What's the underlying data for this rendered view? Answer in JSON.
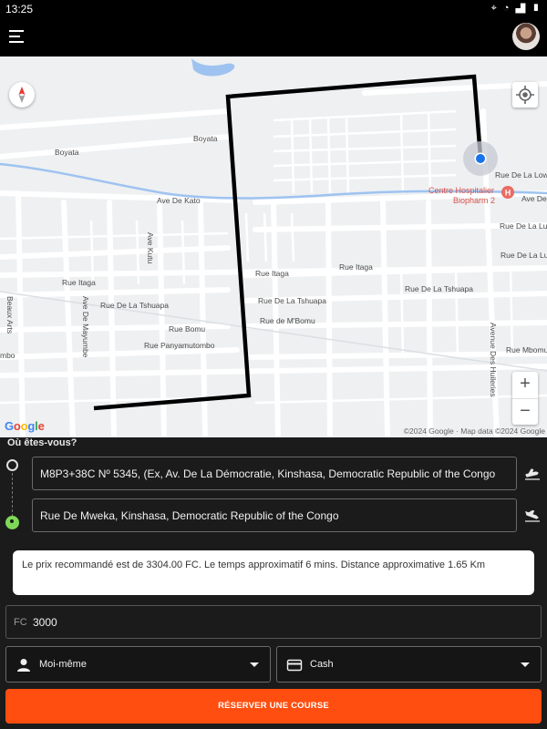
{
  "status_bar": {
    "time": "13:25",
    "icons": [
      "location-icon",
      "wifi-icon",
      "signal-icon",
      "battery-icon"
    ]
  },
  "app_bar": {
    "menu_icon": "hamburger-icon",
    "avatar": "user-avatar"
  },
  "map": {
    "streets": {
      "boyata_1": "Boyata",
      "boyata_2": "Boyata",
      "ave_de_kato": "Ave De Kato",
      "ave_kutu": "Ave Kutu",
      "rue_itaga_1": "Rue Itaga",
      "rue_itaga_2": "Rue Itaga",
      "rue_itaga_3": "Rue Itaga",
      "ave_de_mayumbe": "Ave De Mayumbe",
      "rue_de_la_tshuapa_1": "Rue De La Tshuapa",
      "rue_de_la_tshuapa_2": "Rue De La Tshuapa",
      "rue_de_la_tshuapa_3": "Rue De La Tshuapa",
      "rue_bomu": "Rue Bomu",
      "rue_panyamutombo": "Rue Panyamutombo",
      "rue_de_mbomu": "Rue de M'Bomu",
      "beaux_arts": "Beaux Arts",
      "mbo": "mbo",
      "rue_de_la_lowa": "Rue De La Lowa",
      "ave_de": "Ave De",
      "rue_de_la_luva": "Rue De La Luv",
      "rue_de_la_lu": "Rue De La Lu",
      "avenue_des_huileries": "Avenue Des Huileries",
      "rue_mbomu": "Rue Mbomu"
    },
    "poi": {
      "name": "Centre Hospitalier Biopharm 2",
      "line1": "Centre Hospitalier",
      "line2": "Biopharm 2",
      "icon": "hospital-icon"
    },
    "zoom_in": "+",
    "zoom_out": "−",
    "logo": "Google",
    "attribution": "©2024 Google · Map data ©2024 Google"
  },
  "form": {
    "title": "Où êtes-vous?",
    "pickup": "M8P3+38C Nº 5345, (Ex, Av. De La Démocratie, Kinshasa, Democratic Republic of the Congo",
    "destination": "Rue De Mweka, Kinshasa, Democratic Republic of the Congo",
    "info": "Le prix recommandé est de 3304.00 FC. Le temps approximatif 6 mins. Distance approximative 1.65 Km",
    "currency": "FC",
    "price": "3000",
    "passenger": "Moi-même",
    "payment": "Cash",
    "submit": "RÉSERVER UNE COURSE"
  },
  "colors": {
    "accent": "#ff4e0f",
    "route": "#000000",
    "destination_pin": "#7ed957",
    "location_dot": "#1a73e8"
  }
}
